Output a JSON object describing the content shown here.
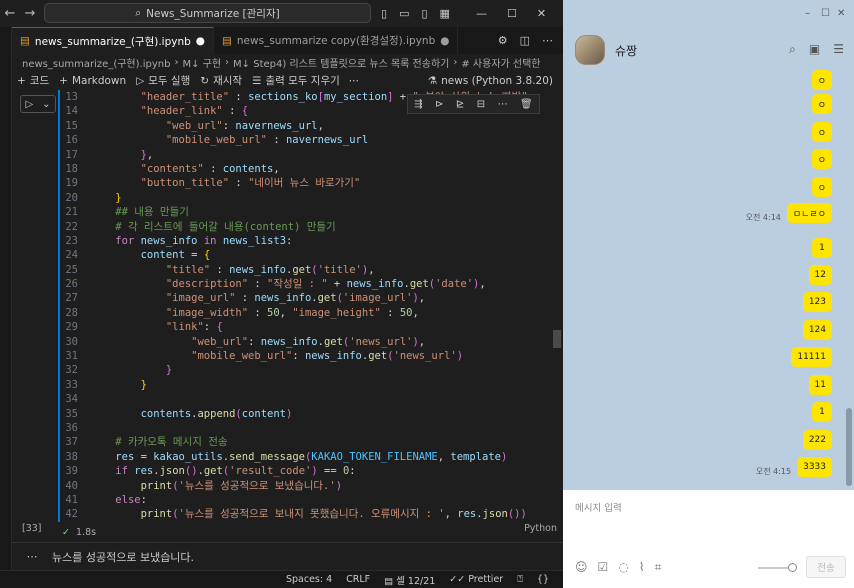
{
  "titlebar": {
    "search_text": "News_Summarize [관리자]"
  },
  "tabs": [
    {
      "label": "news_summarize_(구현).ipynb"
    },
    {
      "label": "news_summarize copy(환경설정).ipynb"
    }
  ],
  "breadcrumb": [
    "news_summarize_(구현).ipynb",
    "M↓ 구현",
    "M↓ Step4) 리스트 템플릿으로 뉴스 목록 전송하기",
    "# 사용자가 선택한"
  ],
  "toolbar": {
    "code": "코드",
    "markdown": "Markdown",
    "run_all": "모두 실행",
    "restart": "재시작",
    "clear_outputs": "출력 모두 지우기",
    "kernel": "news (Python 3.8.20)"
  },
  "cell": {
    "exec_count": "[33]",
    "duration": "1.8s",
    "language": "Python"
  },
  "output": {
    "text": "뉴스를 성공적으로 보냈습니다."
  },
  "status": {
    "spaces": "Spaces: 4",
    "eol": "CRLF",
    "cell_pos": "셀 12/21",
    "prettier": "Prettier"
  },
  "kakao": {
    "name": "슈짱",
    "input_placeholder": "메시지 입력",
    "send_label": "전송",
    "messages": [
      {
        "text": "ㅇ"
      },
      {
        "text": "ㅇ"
      },
      {
        "text": "ㅇ"
      },
      {
        "text": "ㅇ"
      },
      {
        "text": "ㅇ"
      },
      {
        "text": "ㅁㄴㄹㅇ",
        "time": "오전 4:14"
      },
      {
        "text": "1"
      },
      {
        "text": "12"
      },
      {
        "text": "123"
      },
      {
        "text": "124"
      },
      {
        "text": "11111"
      },
      {
        "text": "11"
      },
      {
        "text": "1"
      },
      {
        "text": "222"
      },
      {
        "text": "3333",
        "time": "오전 4:15"
      }
    ]
  }
}
